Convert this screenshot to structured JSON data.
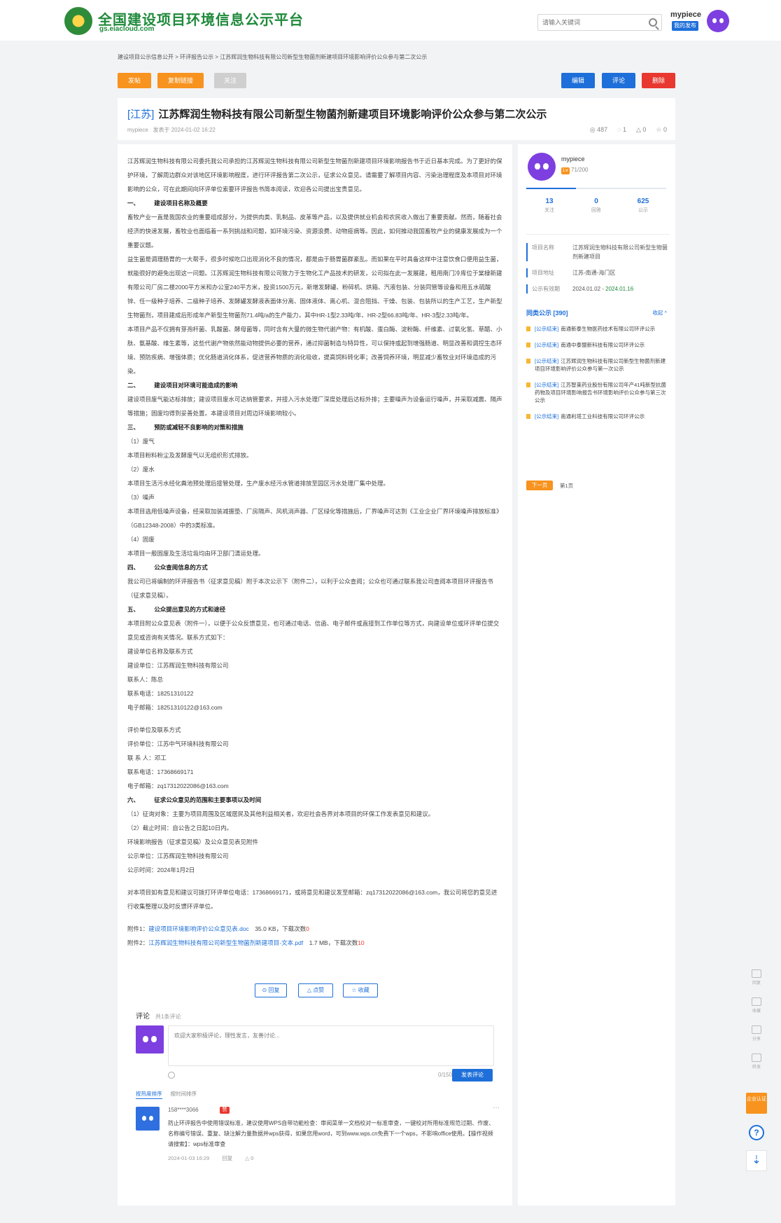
{
  "header": {
    "logo_title": "全国建设项目环境信息公示平台",
    "logo_sub": "gs.eiacloud.com",
    "search_placeholder": "请输入关键词",
    "user_name": "mypiece",
    "user_badge": "我的发布"
  },
  "breadcrumb": "建设项目公示信息公开 > 环评报告公示 > 江苏辉润生物科技有限公司新型生物菌剂新建项目环境影响评价公众参与第二次公示",
  "toolbar": {
    "left": [
      "发帖",
      "复制链接",
      "关注"
    ],
    "right": [
      "编辑",
      "评论",
      "删除"
    ]
  },
  "title_card": {
    "province": "[江苏]",
    "title": "江苏辉润生物科技有限公司新型生物菌剂新建项目环境影响评价公众参与第二次公示",
    "author": "mypiece",
    "posted": "发表于 2024-01-02 16:22",
    "views": "◎ 487",
    "comments": "◌ 1",
    "likes": "△ 0",
    "favorites": "☆ 0"
  },
  "article": [
    {
      "t": "江苏辉润生物科技有限公司委托我公司承担的江苏辉润生物科技有限公司新型生物菌剂新建项目环境影响报告书于近日基本完成。为了更好的保护环境，了解周边群众对该地区环境影响程度，进行环评报告第二次公示，征求公众意见。请需要了解项目内容、污染治理程度及本项目对环境影响的公众，可在此期间向环评单位索要环评报告书简本阅读，欢迎各公司提出宝贵意见。",
      "h": false
    },
    {
      "t": "一、　　　建设项目名称及概要",
      "h": true
    },
    {
      "t": "畜牧产业一直是我国农业的重要组成部分，为提供肉类、乳制品、皮革等产品，以及提供就业机会和农民收入做出了重要贡献。然而，随着社会经济的快速发展，畜牧业也面临着一系列挑战和问题，如环境污染、资源浪费、动物疫病等。因此，如何推动我国畜牧产业的健康发展成为一个重要议题。",
      "h": false
    },
    {
      "t": "益生菌是调理肠胃的一大帮手，很多时候吃口出现消化不良的情况，都是由于肠胃菌群紊乱。而如果在平时具备这样中注意饮食口便用益生菌，就能很好的避免出现这一问题。江苏辉润生物科技有限公司致力于生物化工产品技术的研发，公司拟在此一发展建，租用南门冷库位于棠棣新建有限公司厂房二楼2000平方米和办公室240平方米，投资1500万元，新增发酵罐、粉碎机、烘箱、汽液包装、分装同管等设备和用五水硫酸锌、任一级种子培养、二级种子培养、发酵罐发酵液表面体分离、固体液体、离心机、混合阻挡、干燥、包装、包装所以的生产工艺，生产新型生物菌剂，项目建成后形成年产新型生物菌剂71.4吨/a的生产能力，其中HR-1型2.33吨/年、HR-2型66.83吨/年、HR-3型2.33吨/年。",
      "h": false
    },
    {
      "t": "本项目产品不仅拥有芽孢杆菌、乳酸菌、酵母菌等，同时含有大量的微生物代谢产物：有机酸、蛋白酶、淀粉酶、纤维素、过氧化氢、草醋、小肽、氨基酸、维生素等，这些代谢产物依然能动物提供必要的营养，通过抑菌制造与特异性，可以保持或起到增强肠道、明显改善和调控生态环境、预防疾病、增强体质；优化肠道消化体系，促进营养物质的消化吸收，提高饲料转化率；改善饲养环境，明显减少畜牧业对环境造成的污染。",
      "h": false
    },
    {
      "t": "二、　　　建设项目对环境可能造成的影响",
      "h": true
    },
    {
      "t": "建设项目废气能达标排放；建设项目废水可达纳管要求，并接入污水处理厂深度处理后达标外排；主要噪声为设备运行噪声，并采取减震、隔声等措施；固废均得到妥善处置。本建设项目对周边环境影响较小。",
      "h": false
    },
    {
      "t": "三、　　　预防或减轻不良影响的对策和措施",
      "h": true
    },
    {
      "t": "（1）废气",
      "h": false
    },
    {
      "t": "本项目粉料粉尘及发酵废气以无组织形式排放。",
      "h": false
    },
    {
      "t": "（2）废水",
      "h": false
    },
    {
      "t": "本项目生活污水经化粪池预处理后接管处理，生产废水经污水管道排放至园区污水处理厂集中处理。",
      "h": false
    },
    {
      "t": "（3）噪声",
      "h": false
    },
    {
      "t": "本项目选用低噪声设备，经采取加装减振垫、厂房隔声、风机消声器、厂区绿化等措施后，厂界噪声可达到《工业企业厂界环境噪声排放标准》（GB12348-2008）中的3类标准。",
      "h": false
    },
    {
      "t": "（4）固废",
      "h": false
    },
    {
      "t": "本项目一般固废及生活垃圾均由环卫部门清运处理。",
      "h": false
    },
    {
      "t": "四、　　　公众查阅信息的方式",
      "h": true
    },
    {
      "t": "我公司已将编制的环评报告书（征求意见稿）附于本次公示下（附件二），以利于公众查阅；公众也可通过联系我公司查阅本项目环评报告书（征求意见稿）。",
      "h": false
    },
    {
      "t": "五、　　　公众提出意见的方式和途径",
      "h": true
    },
    {
      "t": "本项目附公众意见表（附件一），以便于公众反馈意见，也可通过电话、信函、电子邮件或直接到工作单位等方式，向建设单位或环评单位提交意见或咨询有关情况。联系方式如下：",
      "h": false
    },
    {
      "t": "建设单位名称及联系方式",
      "h": false
    },
    {
      "t": "建设单位：江苏辉润生物科技有限公司",
      "h": false
    },
    {
      "t": "联系人：陈总",
      "h": false
    },
    {
      "t": "联系电话：18251310122",
      "h": false
    },
    {
      "t": "电子邮箱：18251310122@163.com",
      "h": false
    },
    {
      "t": "",
      "h": false,
      "gap": true
    },
    {
      "t": "评价单位及联系方式",
      "h": false
    },
    {
      "t": "评价单位：江苏中气环境科技有限公司",
      "h": false
    },
    {
      "t": "联 系 人：邓工",
      "h": false
    },
    {
      "t": "联系电话：17368669171",
      "h": false
    },
    {
      "t": "电子邮箱：zq17312022086@163.com",
      "h": false
    },
    {
      "t": "六、　　　征求公众意见的范围和主要事项以及时间",
      "h": true
    },
    {
      "t": "（1）征询对象：主要为项目周围及区域居民及其他利益相关者，欢迎社会各界对本项目的环保工作发表意见和建议。",
      "h": false
    },
    {
      "t": "（2）截止时间：自公告之日起10日内。",
      "h": false
    },
    {
      "t": "环境影响报告（征求意见稿）及公众意见表见附件",
      "h": false
    },
    {
      "t": "公示单位：江苏辉润生物科技有限公司",
      "h": false
    },
    {
      "t": "公示时间：2024年1月2日",
      "h": false
    },
    {
      "t": "",
      "h": false,
      "gap": true
    },
    {
      "t": "对本项目如有意见和建议可拨打环评单位电话：17368669171，或将意见和建议发至邮箱：zq17312022086@163.com，我公司将您的意见进行收集整理以及时反馈环评单位。",
      "h": false
    }
  ],
  "attachments": [
    {
      "label": "附件1：",
      "name": "建设项目环境影响评价公众意见表.doc",
      "size": "35.0 KB，下载次数",
      "downloads": "0"
    },
    {
      "label": "附件2：",
      "name": "江苏辉润生物科技有限公司新型生物菌剂新建项目-文本.pdf",
      "size": "1.7 MB，下载次数",
      "downloads": "10"
    }
  ],
  "actions": [
    "⊙ 回复",
    "△ 点赞",
    "☆ 收藏"
  ],
  "comments": {
    "title": "评论",
    "count": "共1条评论",
    "placeholder": "欢迎大家积极评论，理性发言，友善讨论...",
    "counter": "0/150",
    "submit": "发表评论",
    "sort_active": "按热度排序",
    "sort_other": "按时间排序",
    "item": {
      "user": "158****3066",
      "tag": "赞",
      "text": "防止环评报告中使用错误标准，建议使用WPS自带功能检查：审阅菜单一文档校对一标准审查，一键校对所用标准规范过期、作废、名称编号错误、重复、缺注解力量数据并wps获得，如果您用word，可到www.wps.cn免费下一个wps，不影响office使用。【操作视频请搜索】：wps标准审查",
      "time": "2024-01-03 16:29",
      "reply": "回复",
      "like": "△ 0"
    }
  },
  "sidebar": {
    "name": "mypiece",
    "level": "Lv",
    "score": "71/200",
    "progress": 0.355,
    "stats": [
      {
        "v": "13",
        "l": "关注"
      },
      {
        "v": "0",
        "l": "回答"
      },
      {
        "v": "625",
        "l": "公示"
      }
    ],
    "info": [
      {
        "k": "项目名称",
        "v": "江苏辉润生物科技有限公司新型生物菌剂新建项目",
        "hl": ""
      },
      {
        "k": "项目地址",
        "v": "江苏-南通-海门区",
        "hl": ""
      },
      {
        "k": "公示有效期",
        "v": "2024.01.02 -",
        "hl": " 2024.01.16"
      }
    ],
    "section_title": "同类公示 [390]",
    "section_more": "收起 ^",
    "items": [
      {
        "tag": "[公示结束]",
        "text": "南通新泰生物医药技术有限公司环评公示"
      },
      {
        "tag": "[公示结束]",
        "text": "南通中泰盟新科技有限公司环评公示"
      },
      {
        "tag": "[公示结束]",
        "text": "江苏辉润生物科技有限公司新型生物菌剂新建项目环境影响评价公众参与第一次公示"
      },
      {
        "tag": "[公示结束]",
        "text": "江苏智莱药业股份有限公司年产41吨新型抗菌药物及项目环境影响报告书环境影响评价公众参与第三次公示"
      },
      {
        "tag": "[公示结束]",
        "text": "南通利塔工业科技有限公司环评公示"
      }
    ],
    "pager_btn": "下一页",
    "pager_info": "第1页"
  },
  "floatbar": {
    "items": [
      "回复",
      "收藏",
      "分享",
      "转发"
    ],
    "auth": "企业认证",
    "help": "?",
    "download": "⇣"
  }
}
